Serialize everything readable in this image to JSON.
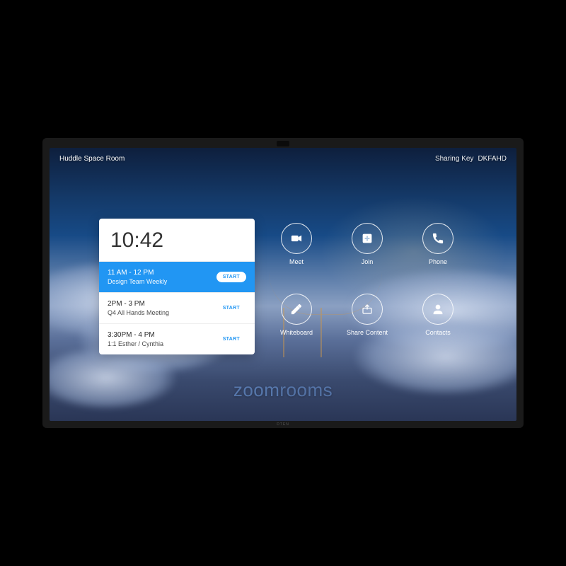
{
  "header": {
    "room_name": "Huddle Space Room",
    "sharing_label": "Sharing Key",
    "sharing_key": "DKFAHD"
  },
  "clock": "10:42",
  "meetings": [
    {
      "time": "11 AM - 12 PM",
      "title": "Design Team Weekly",
      "button": "START",
      "active": true
    },
    {
      "time": "2PM - 3 PM",
      "title": "Q4 All Hands Meeting",
      "button": "START",
      "active": false
    },
    {
      "time": "3:30PM - 4 PM",
      "title": "1:1 Esther / Cynthia",
      "button": "START",
      "active": false
    }
  ],
  "actions": [
    {
      "label": "Meet",
      "icon": "video"
    },
    {
      "label": "Join",
      "icon": "plus"
    },
    {
      "label": "Phone",
      "icon": "phone"
    },
    {
      "label": "Whiteboard",
      "icon": "pencil"
    },
    {
      "label": "Share Content",
      "icon": "share"
    },
    {
      "label": "Contacts",
      "icon": "person"
    }
  ],
  "branding": {
    "logo_main": "zoom",
    "logo_sub": "rooms"
  },
  "device_brand": "DTEN"
}
